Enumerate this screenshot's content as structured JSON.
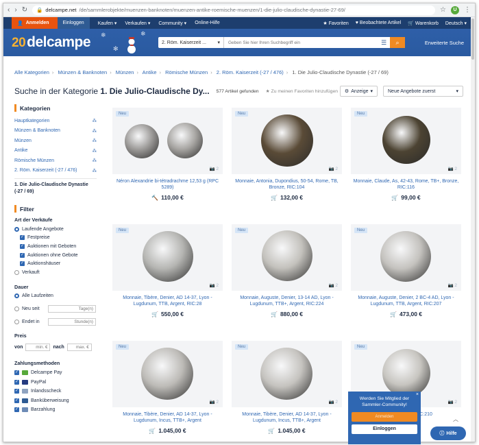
{
  "browser": {
    "url_host": "delcampe.net",
    "url_path": "/de/sammlerobjekte/muenzen-banknoten/muenzen-antike-roemische-muenzen/1-die-julio-claudische-dynastie-27-69/",
    "profile_initial": "U"
  },
  "topnav": {
    "login": "Anmelden",
    "register": "Einloggen",
    "menu": [
      "Kaufen ▾",
      "Verkaufen ▾",
      "Community ▾",
      "Online-Hilfe"
    ],
    "right": [
      "★ Favoriten",
      "♥ Beobachtete Artikel",
      "🛒 Warenkorb",
      "Deutsch ▾"
    ]
  },
  "header": {
    "logo_num": "20",
    "logo_text": "delcampe",
    "search_category": "2. Röm. Kaiserzeit ...",
    "search_placeholder": "Geben Sie hier Ihren Suchbegriff ein",
    "advanced": "Erweiterte Suche"
  },
  "breadcrumb": {
    "items": [
      "Alle Kategorien",
      "Münzen & Banknoten",
      "Münzen",
      "Antike",
      "Römische Münzen",
      "2. Röm. Kaiserzeit (-27 / 476)"
    ],
    "current": "1. Die Julio-Claudische Dynastie (-27 / 69)"
  },
  "titlebar": {
    "prefix": "Suche in der Kategorie ",
    "category": "1. Die Julio-Claudische Dy...",
    "found": "577 Artikel gefunden",
    "favorite": "Zu meinen Favoriten hinzufügen",
    "view": "Anzeige",
    "sort": "Neue Angebote zuerst"
  },
  "sidebar": {
    "categories_title": "Kategorien",
    "categories": [
      "Hauptkategorien",
      "Münzen & Banknoten",
      "Münzen",
      "Antike",
      "Römische Münzen",
      "2. Röm. Kaiserzeit (-27 / 476)"
    ],
    "current_category": "1. Die Julio-Claudische Dynastie (-27 / 69)",
    "filter_title": "Filter",
    "sale_type_title": "Art der Verkäufe",
    "sale_running": "Laufende Angebote",
    "sale_options": [
      "Festpreise",
      "Auktionen mit Geboten",
      "Auktionen ohne Gebote",
      "Auktionshäuser"
    ],
    "sale_sold": "Verkauft",
    "duration_title": "Dauer",
    "duration_all": "Alle Laufzeiten",
    "duration_new": "Neu seit",
    "duration_new_unit": "Tage(n)",
    "duration_end": "Endet in",
    "duration_end_unit": "Stunde(n)",
    "price_title": "Preis",
    "price_from": "von",
    "price_min": "min. €",
    "price_to": "nach",
    "price_max": "max. €",
    "payment_title": "Zahlungsmethoden",
    "payments": [
      "Delcampe Pay",
      "PayPal",
      "Inlandsscheck",
      "Banküberweisung",
      "Barzahlung"
    ]
  },
  "listings": [
    {
      "badge": "Neu",
      "title": "Néron Alexandrie bi-tétradrachme 12,53 g (RPC 5289)",
      "price": "110,00 €",
      "type": "auction",
      "photos": "2"
    },
    {
      "badge": "Neu",
      "title": "Monnaie, Antonia, Dupondius, 50-54, Rome, TB, Bronze, RIC:104",
      "price": "132,00 €",
      "type": "cart",
      "photos": "2"
    },
    {
      "badge": "Neu",
      "title": "Monnaie, Claude, As, 42-43, Rome, TB+, Bronze, RIC:116",
      "price": "99,00 €",
      "type": "cart",
      "photos": "2"
    },
    {
      "badge": "Neu",
      "title": "Monnaie, Tibère, Denier, AD 14-37, Lyon - Lugdunum, TTB, Argent, RIC:28",
      "price": "550,00 €",
      "type": "cart",
      "photos": "2"
    },
    {
      "badge": "Neu",
      "title": "Monnaie, Auguste, Denier, 13-14 AD, Lyon - Lugdunum, TTB+, Argent, RIC:224",
      "price": "880,00 €",
      "type": "cart",
      "photos": "2"
    },
    {
      "badge": "Neu",
      "title": "Monnaie, Auguste, Denier, 2 BC-4 AD, Lyon - Lugdunum, TTB, Argent, RIC:207",
      "price": "473,00 €",
      "type": "cart",
      "photos": "2"
    },
    {
      "badge": "Neu",
      "title": "Monnaie, Tibère, Denier, AD 14-37, Lyon - Lugdunum, Incus, TTB+, Argent",
      "price": "1.045,00 €",
      "type": "cart",
      "photos": "2"
    },
    {
      "badge": "Neu",
      "title": "Monnaie, Tibère, Denier, AD 14-37, Lyon - Lugdunum, Incus, TTB+, Argent",
      "price": "1.045,00 €",
      "type": "cart",
      "photos": "2"
    },
    {
      "badge": "Neu",
      "title": "...C-4 AD, Lyo... RIC:210",
      "price": "",
      "type": "cart",
      "photos": "2"
    }
  ],
  "popup": {
    "message": "Werden Sie Mitglied der Sammler-Community!",
    "register": "Anmelden",
    "login": "Einloggen",
    "close": "×"
  },
  "help": "Hilfe"
}
